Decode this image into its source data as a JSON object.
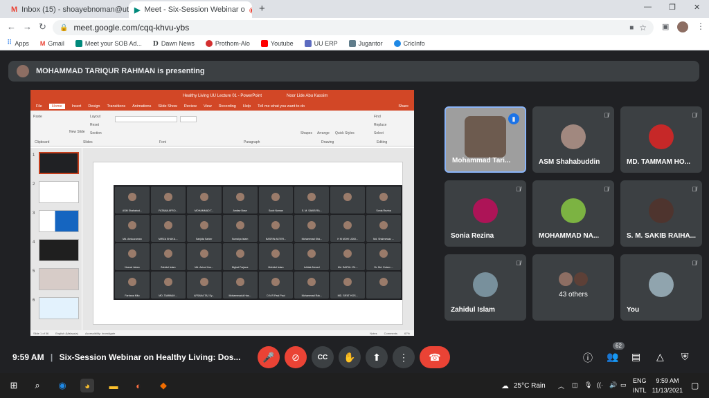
{
  "tabs": [
    {
      "title": "Inbox (15) - shoayebnoman@utt",
      "icon": "gmail-icon"
    },
    {
      "title": "Meet - Six-Session Webinar o",
      "icon": "meet-icon"
    }
  ],
  "new_tab": "+",
  "url": "meet.google.com/cqq-khvu-ybs",
  "bookmarks": [
    "Apps",
    "Gmail",
    "Meet your SOB Ad...",
    "Dawn News",
    "Prothom-Alo",
    "Youtube",
    "UU ERP",
    "Jugantor",
    "CricInfo"
  ],
  "presenting": "MOHAMMAD TARIQUR RAHMAN is presenting",
  "ppt": {
    "title": "Healthy Living UU Lecture 01 - PowerPoint",
    "user": "Noor Lide Abu Kassim",
    "tabs": [
      "File",
      "Home",
      "Insert",
      "Design",
      "Transitions",
      "Animations",
      "Slide Show",
      "Review",
      "View",
      "Recording",
      "Help"
    ],
    "tell": "Tell me what you want to do",
    "share": "Share",
    "groups": [
      "Clipboard",
      "Slides",
      "Font",
      "Paragraph",
      "Drawing",
      "Editing"
    ],
    "ribbon_items": [
      "Paste",
      "New Slide",
      "Layout",
      "Reset",
      "Section",
      "Shapes",
      "Arrange",
      "Quick Styles",
      "Find",
      "Replace",
      "Select"
    ],
    "slide_numbers": [
      "1",
      "2",
      "3",
      "4",
      "5",
      "6"
    ],
    "status": [
      "Slide 1 of 56",
      "English (Malaysia)",
      "Accessibility: Investigate",
      "Notes",
      "Comments",
      "67%"
    ],
    "grid_names": [
      "ASM Shahabud...",
      "FATAMA AFRO...",
      "MOHAMMAD T...",
      "Amitav Bose",
      "Soob Noman",
      "S. M. SAKIB RA...",
      "",
      "Sonia Rezina",
      "Md. Amiuzzaman",
      "MIRZA SHAKIL...",
      "Sanjida Sarker",
      "Sumaiya Islam",
      "NASRIN AKTER...",
      "Mohammad Sha...",
      "H M MOHI UDDI...",
      "Md. Shahnewaz ...",
      "Nusrat Jahan",
      "Zahidul Islam",
      "Md. Azizul Hos...",
      "Nighat Farjana",
      "Mohidul Islam",
      "Ishtiak Ahmed",
      "Md. SAIFUL ISL...",
      "Dr. Md. Golam ...",
      "Farhana Mitu",
      "MD. TAMMAM ...",
      "AFSANA TAJ Sy...",
      "Mohammudul Has...",
      "D N R Paul Paul",
      "Mohammad Rak...",
      "MD. SIFAT HOS...",
      ""
    ]
  },
  "tiles": [
    {
      "name": "Mohammad Tari...",
      "muted": false,
      "speaking": true
    },
    {
      "name": "ASM Shahabuddin",
      "muted": true
    },
    {
      "name": "MD. TAMMAM HO...",
      "muted": true
    },
    {
      "name": "Sonia Rezina",
      "muted": true
    },
    {
      "name": "MOHAMMAD NA...",
      "muted": true
    },
    {
      "name": "S. M. SAKIB RAIHA...",
      "muted": true
    },
    {
      "name": "Zahidul Islam",
      "muted": true
    },
    {
      "name": "43 others",
      "muted": false
    },
    {
      "name": "You",
      "muted": true
    }
  ],
  "meeting": {
    "time": "9:59 AM",
    "separator": "|",
    "title": "Six-Session Webinar on Healthy Living: Dos...",
    "participants": "62"
  },
  "taskbar": {
    "weather": "25°C Rain",
    "lang1": "ENG",
    "lang2": "INTL",
    "time": "9:59 AM",
    "date": "11/13/2021"
  }
}
